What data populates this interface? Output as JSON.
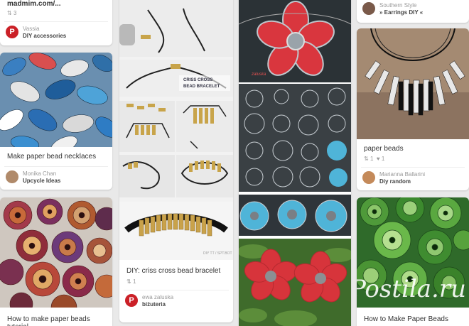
{
  "cards": {
    "c1_top": {
      "title": "madmim.com/...",
      "count": "3",
      "pinner": "Vassia",
      "board": "DIY accessories"
    },
    "c1_mid": {
      "desc": "Make paper bead necklaces",
      "pinner": "Monika Chan",
      "board": "Upcycle Ideas"
    },
    "c1_bot": {
      "desc": "How to make paper beads tutorial"
    },
    "c2": {
      "desc": "DIY: criss cross bead bracelet",
      "count": "1",
      "pinner": "ewa zaluska",
      "board": "biżuteria",
      "img_caption_1": "CRISS CROSS",
      "img_caption_2": "BEAD BRACELET",
      "img_caption_3": "DIY TT / SPT.BOT"
    },
    "c3": {
      "img_caption": "zaluska"
    },
    "c4_top": {
      "pinner": "Southern Style",
      "board": "» Earrings DIY «"
    },
    "c4_mid": {
      "desc": "paper beads",
      "repins": "1",
      "likes": "1",
      "pinner": "Marianna Ballarini",
      "board": "Diy random"
    },
    "c4_bot": {
      "desc": "How to Make Paper Beads",
      "watermark": "Postila.ru"
    }
  }
}
